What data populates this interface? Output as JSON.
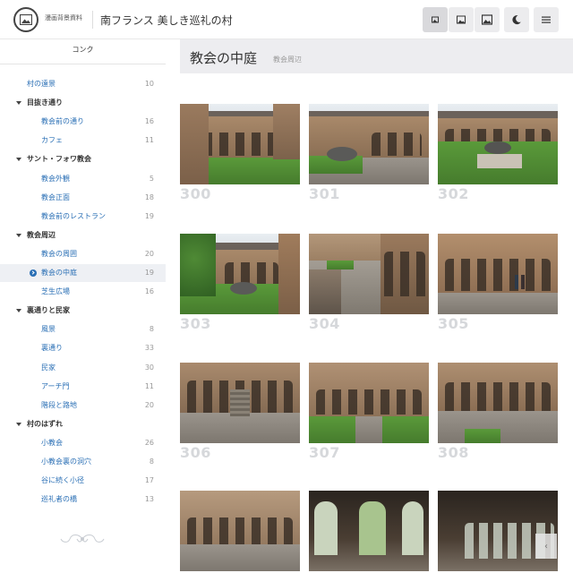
{
  "header": {
    "site_small": "漫画背景資料",
    "site_title": "南フランス 美しき巡礼の村",
    "buttons": [
      "image-small",
      "image-medium",
      "image-large",
      "dark-mode",
      "menu"
    ]
  },
  "sidebar": {
    "heading": "コンク",
    "items": [
      {
        "label": "村の遠景",
        "count": "10",
        "kind": "l1"
      },
      {
        "label": "目抜き通り",
        "count": "",
        "kind": "group"
      },
      {
        "label": "教会前の通り",
        "count": "16",
        "kind": "l2"
      },
      {
        "label": "カフェ",
        "count": "11",
        "kind": "l2"
      },
      {
        "label": "サント・フォワ教会",
        "count": "",
        "kind": "group"
      },
      {
        "label": "教会外観",
        "count": "5",
        "kind": "l2"
      },
      {
        "label": "教会正面",
        "count": "18",
        "kind": "l2"
      },
      {
        "label": "教会前のレストラン",
        "count": "19",
        "kind": "l2"
      },
      {
        "label": "教会周辺",
        "count": "",
        "kind": "group"
      },
      {
        "label": "教会の周囲",
        "count": "20",
        "kind": "l2"
      },
      {
        "label": "教会の中庭",
        "count": "19",
        "kind": "l2",
        "current": true
      },
      {
        "label": "芝生広場",
        "count": "16",
        "kind": "l2"
      },
      {
        "label": "裏通りと民家",
        "count": "",
        "kind": "group"
      },
      {
        "label": "風景",
        "count": "8",
        "kind": "l2"
      },
      {
        "label": "裏通り",
        "count": "33",
        "kind": "l2"
      },
      {
        "label": "民家",
        "count": "30",
        "kind": "l2"
      },
      {
        "label": "アーチ門",
        "count": "11",
        "kind": "l2"
      },
      {
        "label": "階段と路地",
        "count": "20",
        "kind": "l2"
      },
      {
        "label": "村のはずれ",
        "count": "",
        "kind": "group"
      },
      {
        "label": "小教会",
        "count": "26",
        "kind": "l2"
      },
      {
        "label": "小教会裏の洞穴",
        "count": "8",
        "kind": "l2"
      },
      {
        "label": "谷に続く小径",
        "count": "17",
        "kind": "l2"
      },
      {
        "label": "巡礼者の橋",
        "count": "13",
        "kind": "l2"
      }
    ]
  },
  "main": {
    "title": "教会の中庭",
    "subtitle": "教会周辺",
    "photos": [
      {
        "number": "300",
        "scene": "courtyard-lawn-tower"
      },
      {
        "number": "301",
        "scene": "courtyard-fountain"
      },
      {
        "number": "302",
        "scene": "courtyard-lawn-wide"
      },
      {
        "number": "303",
        "scene": "courtyard-tree"
      },
      {
        "number": "304",
        "scene": "stone-path"
      },
      {
        "number": "305",
        "scene": "arcade-visitors"
      },
      {
        "number": "306",
        "scene": "arcade-stairs"
      },
      {
        "number": "307",
        "scene": "cloister-lawn"
      },
      {
        "number": "308",
        "scene": "cloister-stone"
      },
      {
        "number": "",
        "scene": "cloister-facade"
      },
      {
        "number": "",
        "scene": "gallery-dark"
      },
      {
        "number": "",
        "scene": "gallery-dark-wide"
      }
    ]
  }
}
